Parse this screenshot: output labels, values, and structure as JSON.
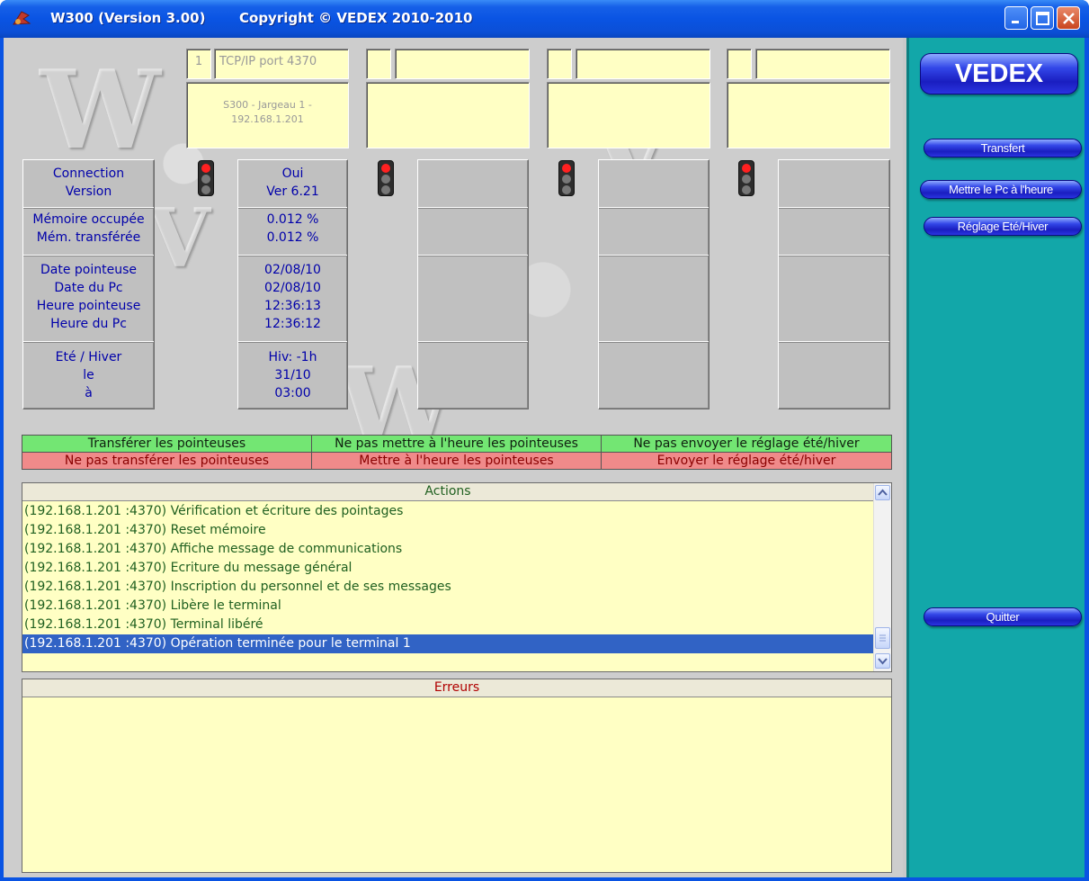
{
  "window": {
    "title_app": "W300  (Version 3.00)",
    "title_copyright": "Copyright ©  VEDEX  2010-2010"
  },
  "terminals": [
    {
      "number": "1",
      "connection": "TCP/IP port 4370",
      "name": "S300 - Jargeau 1 -",
      "ip": "192.168.1.201"
    },
    {
      "number": "",
      "connection": "",
      "name": "",
      "ip": ""
    },
    {
      "number": "",
      "connection": "",
      "name": "",
      "ip": ""
    },
    {
      "number": "",
      "connection": "",
      "name": "",
      "ip": ""
    }
  ],
  "labels": {
    "connection": "Connection",
    "version": "Version",
    "memory_used": "Mémoire occupée",
    "memory_transferred": "Mém. transférée",
    "clock_date": "Date pointeuse",
    "pc_date": "Date du Pc",
    "clock_time": "Heure pointeuse",
    "pc_time": "Heure du Pc",
    "dst": "Eté / Hiver",
    "on": "le",
    "at": "à"
  },
  "values": {
    "connection": "Oui",
    "version": "Ver 6.21",
    "memory_used": "0.012 %",
    "memory_transferred": "0.012 %",
    "clock_date": "02/08/10",
    "pc_date": "02/08/10",
    "clock_time": "12:36:13",
    "pc_time": "12:36:12",
    "dst": "Hiv: -1h",
    "dst_date": "31/10",
    "dst_time": "03:00"
  },
  "options": {
    "transfer_yes": "Transférer les pointeuses",
    "transfer_no": "Ne pas transférer les pointeuses",
    "settime_no": "Ne pas mettre à l'heure les pointeuses",
    "settime_yes": "Mettre à l'heure les pointeuses",
    "dst_no": "Ne pas envoyer le réglage été/hiver",
    "dst_yes": "Envoyer le réglage été/hiver"
  },
  "actions": {
    "title": "Actions",
    "rows": [
      "(192.168.1.201  :4370) Vérification et écriture des pointages",
      "(192.168.1.201  :4370) Reset mémoire",
      "(192.168.1.201  :4370) Affiche message de communications",
      "(192.168.1.201  :4370) Ecriture du message général",
      "(192.168.1.201  :4370) Inscription du personnel et de ses messages",
      "(192.168.1.201  :4370) Libère le terminal",
      "(192.168.1.201  :4370) Terminal libéré",
      "(192.168.1.201  :4370) Opération terminée pour le terminal 1"
    ],
    "selected_index": 7
  },
  "errors": {
    "title": "Erreurs"
  },
  "sidebar": {
    "logo": "VEDEX",
    "transfer": "Transfert",
    "set_pc_time": "Mettre le Pc à l'heure",
    "dst_setting": "Réglage Eté/Hiver",
    "quit": "Quitter"
  },
  "colors": {
    "title_bar": "#0a54e3",
    "panel_yellow": "#ffffc4",
    "sidebar_teal": "#12a7a9",
    "option_green": "#73e673",
    "option_red": "#f08a8a",
    "selection_blue": "#3163c5"
  }
}
